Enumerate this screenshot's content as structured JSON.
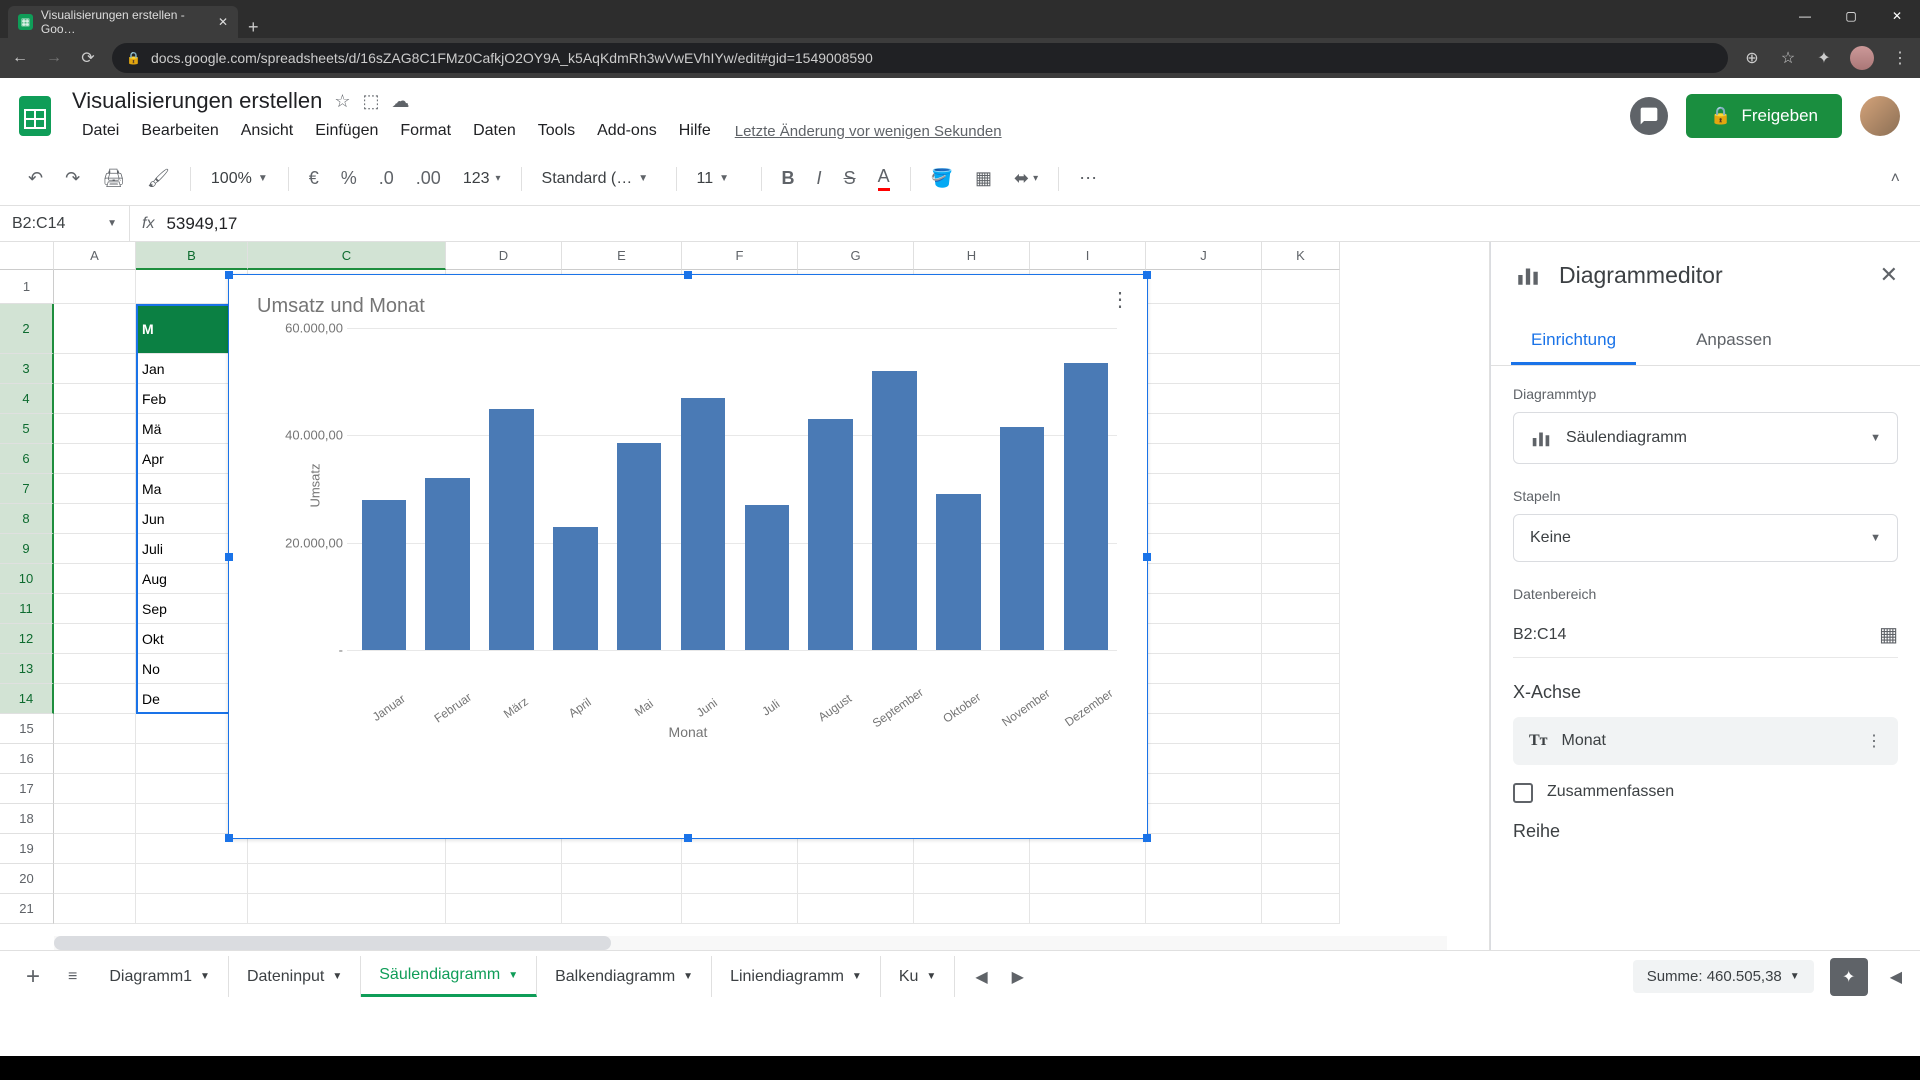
{
  "browser": {
    "tab_title": "Visualisierungen erstellen - Goo…",
    "url": "docs.google.com/spreadsheets/d/16sZAG8C1FMz0CafkjO2OY9A_k5AqKdmRh3wVwEVhIYw/edit#gid=1549008590"
  },
  "doc": {
    "title": "Visualisierungen erstellen",
    "last_edit": "Letzte Änderung vor wenigen Sekunden"
  },
  "menu": [
    "Datei",
    "Bearbeiten",
    "Ansicht",
    "Einfügen",
    "Format",
    "Daten",
    "Tools",
    "Add-ons",
    "Hilfe"
  ],
  "toolbar": {
    "zoom": "100%",
    "font": "Standard (…",
    "font_size": "11"
  },
  "share_label": "Freigeben",
  "name_box": "B2:C14",
  "formula_value": "53949,17",
  "columns": [
    "A",
    "B",
    "C",
    "D",
    "E",
    "F",
    "G",
    "H",
    "I",
    "J",
    "K"
  ],
  "selected_cols": [
    "B",
    "C"
  ],
  "rows_count": 21,
  "selected_rows_from": 2,
  "selected_rows_to": 14,
  "sheet_data": {
    "header_b": "M",
    "months_short": [
      "Jan",
      "Feb",
      "Mä",
      "Apr",
      "Ma",
      "Jun",
      "Juli",
      "Aug",
      "Sep",
      "Okt",
      "No",
      "De"
    ]
  },
  "chart_data": {
    "type": "bar",
    "title": "Umsatz und Monat",
    "xlabel": "Monat",
    "ylabel": "Umsatz",
    "ylim": [
      0,
      60000
    ],
    "y_ticks": [
      "-",
      "20.000,00",
      "40.000,00",
      "60.000,00"
    ],
    "categories": [
      "Januar",
      "Februar",
      "März",
      "April",
      "Mai",
      "Juni",
      "Juli",
      "August",
      "September",
      "Oktober",
      "November",
      "Dezember"
    ],
    "values": [
      28000,
      32000,
      45000,
      23000,
      38500,
      47000,
      27000,
      43000,
      52000,
      29000,
      41500,
      53500
    ]
  },
  "sidebar": {
    "title": "Diagrammeditor",
    "tabs": [
      "Einrichtung",
      "Anpassen"
    ],
    "active_tab": "Einrichtung",
    "chart_type_label": "Diagrammtyp",
    "chart_type_value": "Säulendiagramm",
    "stacking_label": "Stapeln",
    "stacking_value": "Keine",
    "data_range_label": "Datenbereich",
    "data_range_value": "B2:C14",
    "x_axis_title": "X-Achse",
    "x_axis_value": "Monat",
    "aggregate_label": "Zusammenfassen",
    "series_title": "Reihe"
  },
  "sheet_tabs": [
    "Diagramm1",
    "Dateninput",
    "Säulendiagramm",
    "Balkendiagramm",
    "Liniendiagramm",
    "Ku"
  ],
  "active_sheet": "Säulendiagramm",
  "bottom_sum": "Summe: 460.505,38"
}
